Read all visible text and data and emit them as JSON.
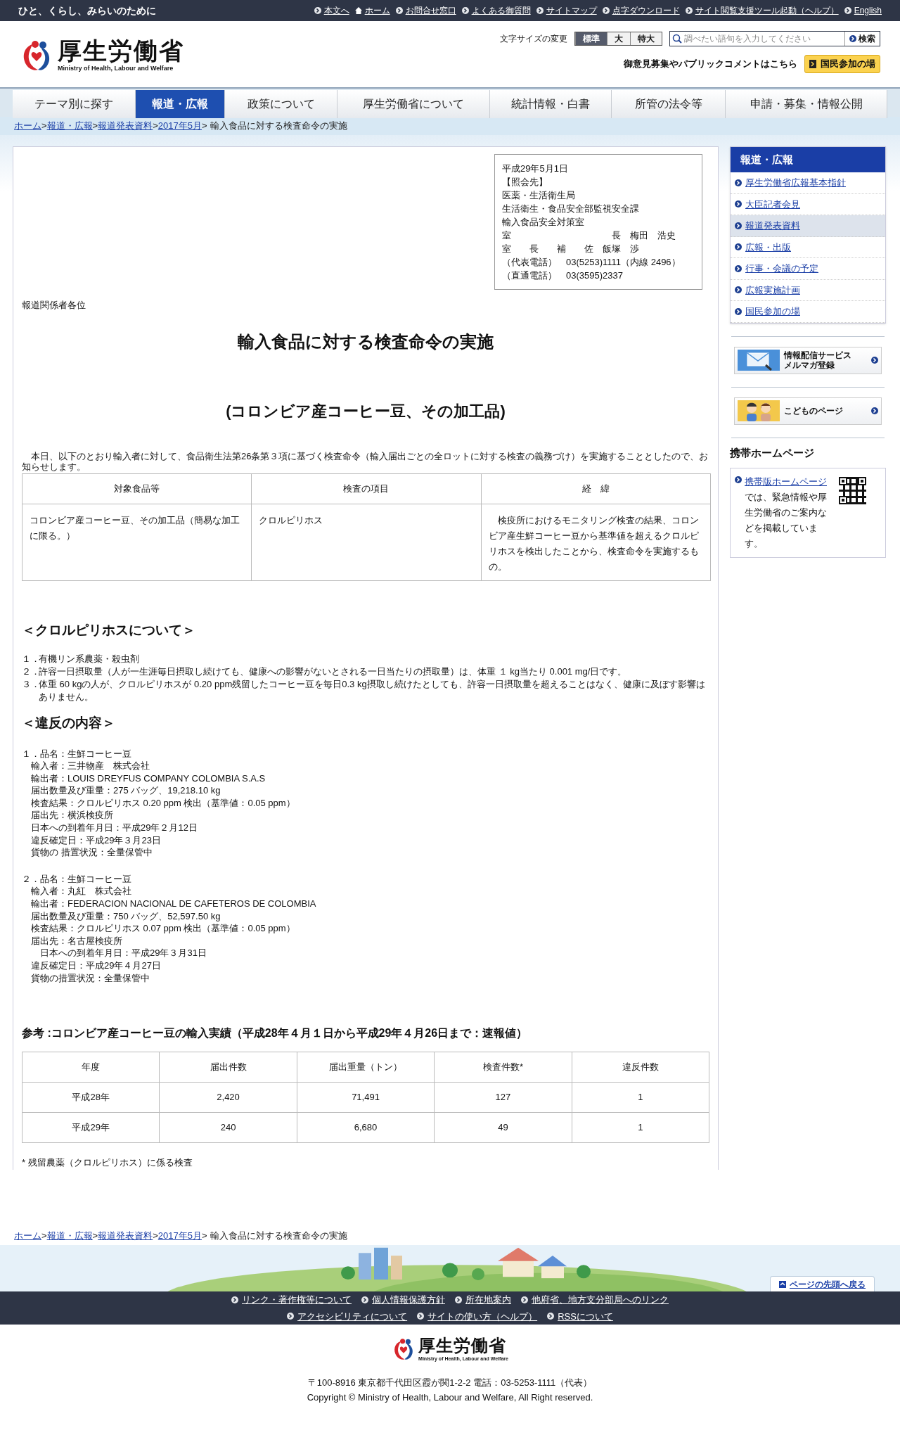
{
  "top_bar": {
    "tagline": "ひと、くらし、みらいのために",
    "links": [
      {
        "kind": "bullet",
        "label": "本文へ"
      },
      {
        "kind": "home",
        "label": "ホーム"
      },
      {
        "kind": "bullet",
        "label": "お問合せ窓口"
      },
      {
        "kind": "bullet",
        "label": "よくある御質問"
      },
      {
        "kind": "bullet",
        "label": "サイトマップ"
      },
      {
        "kind": "bullet",
        "label": "点字ダウンロード"
      },
      {
        "kind": "bullet",
        "label": "サイト閲覧支援ツール起動（ヘルプ）"
      },
      {
        "kind": "bullet",
        "label": "English"
      }
    ]
  },
  "header": {
    "logo_name": "厚生労働省",
    "logo_sub": "Ministry of Health, Labour and Welfare",
    "font_size_label": "文字サイズの変更",
    "font_sizes": [
      {
        "label": "標準",
        "selected": true
      },
      {
        "label": "大",
        "selected": false
      },
      {
        "label": "特大",
        "selected": false
      }
    ],
    "search": {
      "placeholder": "調べたい語句を入力してください",
      "button": "検索"
    },
    "comment_text": "御意見募集やパブリックコメントはこちら",
    "participation_button": "国民参加の場"
  },
  "nav": [
    {
      "label": "テーマ別に探す",
      "selected": false
    },
    {
      "label": "報道・広報",
      "selected": true
    },
    {
      "label": "政策について",
      "selected": false
    },
    {
      "label": "厚生労働省について",
      "selected": false
    },
    {
      "label": "統計情報・白書",
      "selected": false
    },
    {
      "label": "所管の法令等",
      "selected": false
    },
    {
      "label": "申請・募集・情報公開",
      "selected": false
    }
  ],
  "breadcrumb": {
    "separator": ">",
    "links": [
      "ホーム",
      "報道・広報",
      "報道発表資料",
      "2017年5月"
    ],
    "current": "輸入食品に対する検査命令の実施"
  },
  "contact_box": {
    "lines": [
      "平成29年5月1日",
      "【照会先】",
      "医薬・生活衛生局",
      "生活衛生・食品安全部監視安全課",
      "輸入食品安全対策室",
      "室　　　　　　　　　　　長　梅田　浩史",
      "室　　長　　補　　佐　飯塚　渉",
      "（代表電話）　03(5253)1111（内線 2496）",
      "（直通電話）　03(3595)2337"
    ]
  },
  "addressee": "報道関係者各位",
  "title": "輸入食品に対する検査命令の実施",
  "subtitle": "(コロンビア産コーヒー豆、その加工品)",
  "intro": "　本日、以下のとおり輸入者に対して、食品衛生法第26条第３項に基づく検査命令（輸入届出ごとの全ロットに対する検査の義務づけ）を実施することとしたので、お知らせします。",
  "order_table": {
    "columns": [
      "対象食品等",
      "検査の項目",
      "経　緯"
    ],
    "rows": [
      [
        "コロンビア産コーヒー豆、その加工品（簡易な加工に限る。）",
        "クロルピリホス",
        "　検疫所におけるモニタリング検査の結果、コロンビア産生鮮コーヒー豆から基準値を超えるクロルピリホスを検出したことから、検査命令を実施するもの。"
      ]
    ]
  },
  "chlorpyrifos": {
    "heading": "＜クロルピリホスについて＞",
    "items": [
      {
        "number": "１．",
        "text": "有機リン系農薬・殺虫剤"
      },
      {
        "number": "２．",
        "text": "許容一日摂取量（人が一生涯毎日摂取し続けても、健康への影響がないとされる一日当たりの摂取量）は、体重 １ kg当たり 0.001 mg/日です。"
      },
      {
        "number": "３．",
        "text": "体重 60 kgの人が、クロルピリホスが 0.20 ppm残留したコーヒー豆を毎日0.3 kg摂取し続けたとしても、許容一日摂取量を超えることはなく、健康に及ぼす影響はありません。"
      }
    ]
  },
  "violations": {
    "heading": "＜違反の内容＞",
    "cases": [
      {
        "lines": [
          "１．品名：生鮮コーヒー豆",
          "　輸入者：三井物産　株式会社",
          "　輸出者：LOUIS DREYFUS COMPANY COLOMBIA S.A.S",
          "　届出数量及び重量：275 バッグ、19,218.10 kg",
          "　検査結果：クロルピリホス 0.20 ppm 検出（基準値：0.05 ppm）",
          "　届出先：横浜検疫所",
          "　日本への到着年月日：平成29年２月12日",
          "　違反確定日：平成29年３月23日",
          "　貨物の 措置状況：全量保管中"
        ]
      },
      {
        "lines": [
          "２．品名：生鮮コーヒー豆",
          "　輸入者：丸紅　株式会社",
          "　輸出者：FEDERACION NACIONAL DE CAFETEROS DE COLOMBIA",
          "　届出数量及び重量：750 バッグ、52,597.50 kg",
          "　検査結果：クロルピリホス 0.07 ppm 検出（基準値：0.05 ppm）",
          "　届出先：名古屋検疫所",
          "　　日本への到着年月日：平成29年３月31日",
          "　違反確定日：平成29年４月27日",
          "　貨物の措置状況：全量保管中"
        ]
      }
    ]
  },
  "reference": {
    "heading": "参考 :コロンビア産コーヒー豆の輸入実績（平成28年４月１日から平成29年４月26日まで：速報値）",
    "columns": [
      "年度",
      "届出件数",
      "届出重量（トン）",
      "検査件数*",
      "違反件数"
    ],
    "rows": [
      [
        "平成28年",
        "2,420",
        "71,491",
        "127",
        "1"
      ],
      [
        "平成29年",
        "240",
        "6,680",
        "49",
        "1"
      ]
    ],
    "note": "* 残留農薬（クロルピリホス）に係る検査"
  },
  "bottom_breadcrumb": {
    "separator": ">",
    "links": [
      "ホーム",
      "報道・広報",
      "報道発表資料",
      "2017年5月"
    ],
    "current": "輸入食品に対する検査命令の実施"
  },
  "sidebar": {
    "heading": "報道・広報",
    "items": [
      {
        "label": "厚生労働省広報基本指針",
        "selected": false
      },
      {
        "label": "大臣記者会見",
        "selected": false
      },
      {
        "label": "報道発表資料",
        "selected": true
      },
      {
        "label": "広報・出版",
        "selected": false
      },
      {
        "label": "行事・会議の予定",
        "selected": false
      },
      {
        "label": "広報実施計画",
        "selected": false
      },
      {
        "label": "国民参加の場",
        "selected": false
      }
    ],
    "banners": [
      {
        "kind": "mail",
        "lines": [
          "情報配信サービス",
          "メルマガ登録"
        ]
      },
      {
        "kind": "kids",
        "lines": [
          "こどものページ"
        ]
      }
    ],
    "mobile": {
      "heading": "携帯ホームページ",
      "link": "携帯版ホームページ",
      "text": "では、緊急情報や厚生労働省のご案内などを掲載しています。"
    }
  },
  "footer": {
    "page_top": "ページの先頭へ戻る",
    "link_rows": [
      [
        "リンク・著作権等について",
        "個人情報保護方針",
        "所在地案内",
        "他府省、地方支分部局へのリンク"
      ],
      [
        "アクセシビリティについて",
        "サイトの使い方（ヘルプ）",
        "RSSについて"
      ]
    ],
    "logo_name": "厚生労働省",
    "logo_sub": "Ministry of Health, Labour and Welfare",
    "address": "〒100-8916 東京都千代田区霞が関1-2-2 電話：03-5253-1111（代表）",
    "copyright": "Copyright © Ministry of Health, Labour and Welfare, All Right reserved."
  }
}
